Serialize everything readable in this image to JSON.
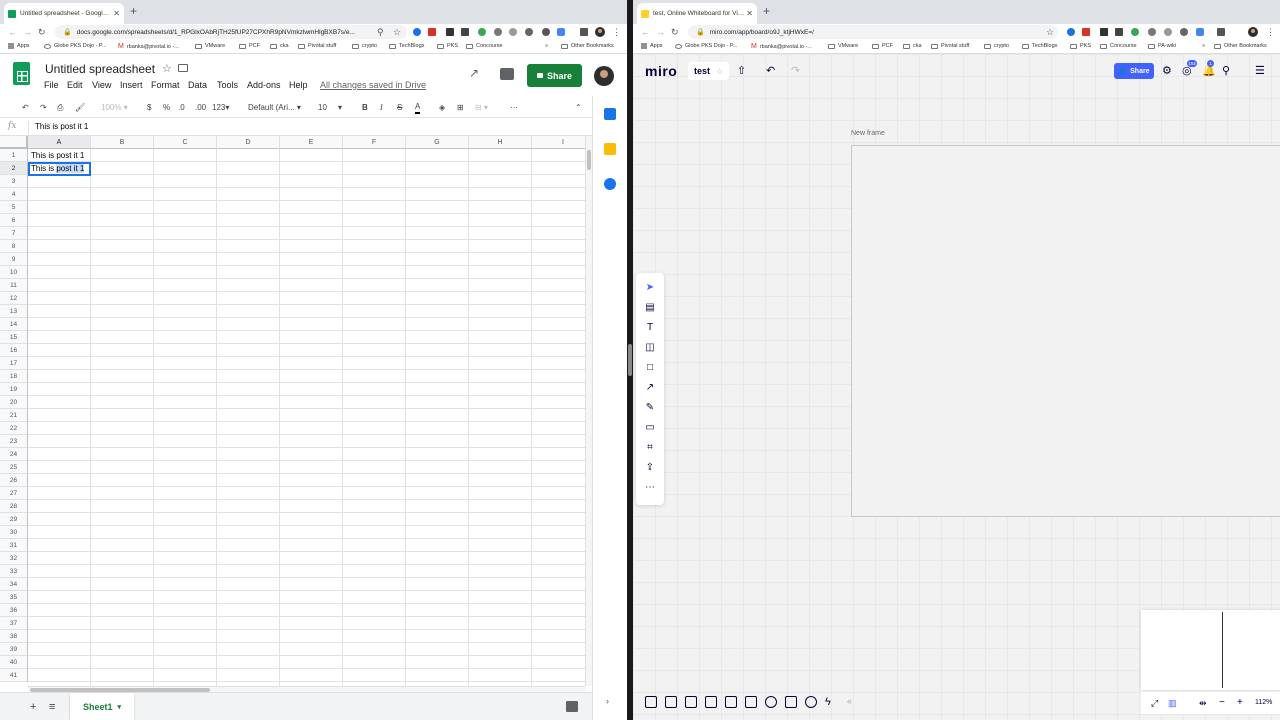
{
  "left_browser": {
    "tab_title": "Untitled spreadsheet - Google Sheets",
    "url": "docs.google.com/spreadsheets/d/1_RPGlxOAbRjTH25fUP27CPXhR9pNVmkzlwmHlgBXB7s/e...",
    "bookmarks": [
      "Apps",
      "Globe PKS Dojo - P...",
      "rbanka@pivotal.io -...",
      "VMware",
      "PCF",
      "cka",
      "Pivotal stuff",
      "crypto",
      "TechBlogs",
      "PKS",
      "Concourse"
    ],
    "bookmarks_more": "»",
    "other_bookmarks": "Other Bookmarks"
  },
  "sheets": {
    "title": "Untitled spreadsheet",
    "menu": [
      "File",
      "Edit",
      "View",
      "Insert",
      "Format",
      "Data",
      "Tools",
      "Add-ons",
      "Help"
    ],
    "save_status": "All changes saved in Drive",
    "share_label": "Share",
    "toolbar": {
      "zoom": "100%",
      "currency": "$",
      "percent": "%",
      "dec_less": ".0",
      "dec_more": ".00",
      "number_format": "123",
      "font": "Default (Ari...",
      "font_size": "10",
      "bold": "B",
      "italic": "I",
      "strike": "S",
      "text_color": "A",
      "more": "⋯"
    },
    "formula_icon": "fx",
    "formula_value": "This is post it 1",
    "columns": [
      "A",
      "B",
      "C",
      "D",
      "E",
      "F",
      "G",
      "H",
      "I"
    ],
    "rows": [
      "1",
      "2",
      "3",
      "4",
      "5",
      "6",
      "7",
      "8",
      "9",
      "10",
      "11",
      "12",
      "13",
      "14",
      "15",
      "16",
      "17",
      "18",
      "19",
      "20",
      "21",
      "22",
      "23",
      "24",
      "25",
      "26",
      "27",
      "28",
      "29",
      "30",
      "31",
      "32",
      "33",
      "34",
      "35",
      "36",
      "37",
      "38",
      "39",
      "40",
      "41"
    ],
    "cells": {
      "A1": "This is post it 1",
      "A2_plain": "This is ",
      "A2_highlight": "post it 1"
    },
    "sheet_tab": "Sheet1"
  },
  "right_browser": {
    "tab_title": "test, Online Whiteboard for Visual Collaboration",
    "url": "miro.com/app/board/o9J_ktjHWxE=/",
    "bookmarks": [
      "Apps",
      "Globe PKS Dojo - P...",
      "rbanka@pivotal.io -...",
      "VMware",
      "PCF",
      "cka",
      "Pivotal stuff",
      "crypto",
      "TechBlogs",
      "PKS",
      "Concourse",
      "PA-wiki"
    ],
    "bookmarks_more": "»",
    "other_bookmarks": "Other Bookmarks"
  },
  "miro": {
    "logo": "miro",
    "board_name": "test",
    "share_label": "Share",
    "badge_1": "164",
    "badge_2": "1",
    "frame_label": "New frame",
    "zoom": "112%",
    "collapse": "«"
  },
  "colors": {
    "sheets_green": "#188038",
    "selection_blue": "#1a73e8",
    "miro_blue": "#4262ff"
  }
}
